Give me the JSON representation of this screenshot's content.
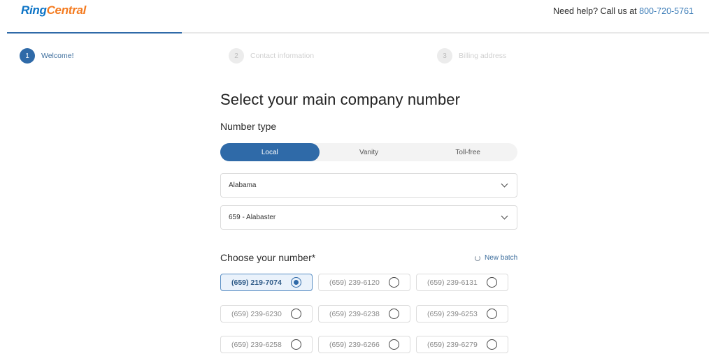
{
  "header": {
    "logo_part1": "Ring",
    "logo_part2": "Central",
    "help_text": "Need help? Call us at",
    "help_phone": "800-720-5761"
  },
  "steps": [
    {
      "num": "1",
      "label": "Welcome!",
      "state": "active"
    },
    {
      "num": "2",
      "label": "Contact information",
      "state": "inactive"
    },
    {
      "num": "3",
      "label": "Billing address",
      "state": "inactive"
    }
  ],
  "main": {
    "title": "Select your main company number",
    "number_type_label": "Number type",
    "number_types": [
      "Local",
      "Vanity",
      "Toll-free"
    ],
    "selected_type": "Local",
    "state_select": "Alabama",
    "area_select": "659 - Alabaster",
    "choose_label": "Choose your number*",
    "new_batch_label": "New batch",
    "numbers": [
      "(659) 219-7074",
      "(659) 239-6120",
      "(659) 239-6131",
      "(659) 239-6230",
      "(659) 239-6238",
      "(659) 239-6253",
      "(659) 239-6258",
      "(659) 239-6266",
      "(659) 239-6279"
    ],
    "selected_number": "(659) 219-7074"
  },
  "colors": {
    "brand_blue": "#0d74c6",
    "brand_orange": "#f47b20",
    "accent": "#2f6aa8"
  }
}
